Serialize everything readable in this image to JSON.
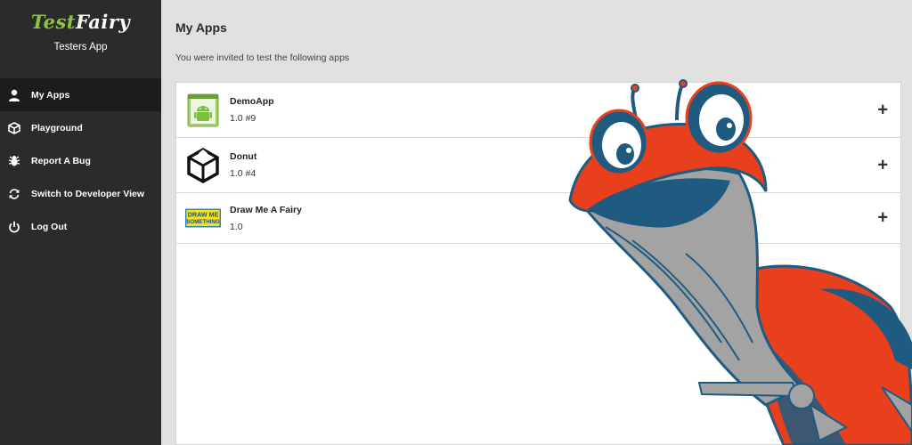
{
  "brand": {
    "logo_word1": "Test",
    "logo_word2": "Fairy",
    "subtitle": "Testers App"
  },
  "nav": [
    {
      "label": "My Apps",
      "icon": "user-icon",
      "active": true
    },
    {
      "label": "Playground",
      "icon": "cube-icon",
      "active": false
    },
    {
      "label": "Report A Bug",
      "icon": "bug-icon",
      "active": false
    },
    {
      "label": "Switch to Developer View",
      "icon": "refresh-icon",
      "active": false
    },
    {
      "label": "Log Out",
      "icon": "power-icon",
      "active": false
    }
  ],
  "main": {
    "title": "My Apps",
    "subtitle": "You were invited to test the following apps",
    "apps": [
      {
        "name": "DemoApp",
        "version": "1.0 #9",
        "icon": "android-app-icon"
      },
      {
        "name": "Donut",
        "version": "1.0 #4",
        "icon": "unity-logo-icon"
      },
      {
        "name": "Draw Me A Fairy",
        "version": "1.0",
        "icon": "draw-something-icon",
        "icon_text_1": "DRAW ME",
        "icon_text_2": "SOMETHING"
      }
    ],
    "expand_symbol": "+"
  },
  "colors": {
    "sidebar_bg": "#2b2b2b",
    "accent_green": "#8cc63f",
    "mascot_orange": "#e8401c",
    "mascot_blue": "#1f5b80"
  }
}
